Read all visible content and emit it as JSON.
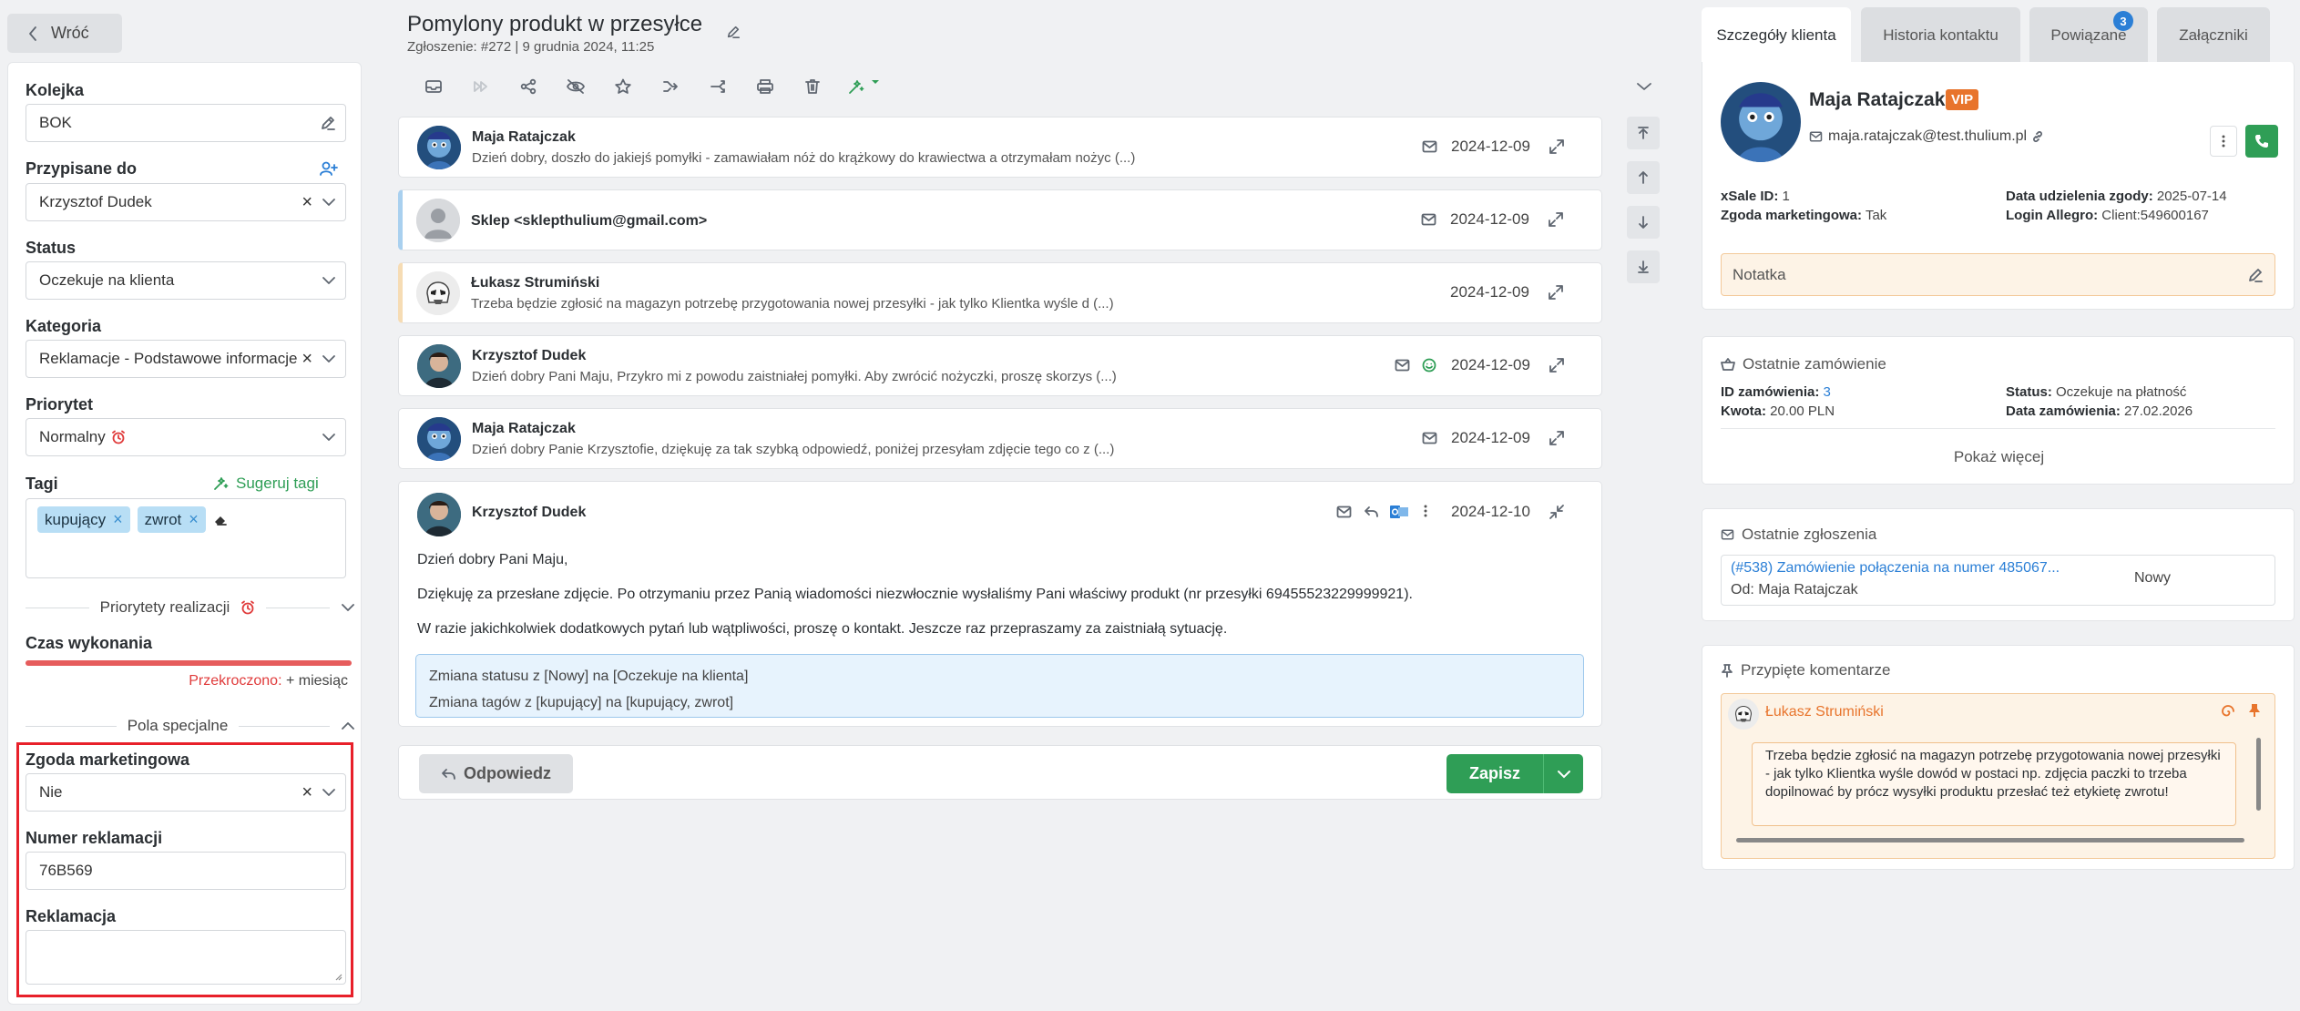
{
  "nav": {
    "back_label": "Wróć"
  },
  "left": {
    "queue": {
      "label": "Kolejka",
      "value": "BOK"
    },
    "assigned": {
      "label": "Przypisane do",
      "value": "Krzysztof Dudek"
    },
    "status": {
      "label": "Status",
      "value": "Oczekuje na klienta"
    },
    "category": {
      "label": "Kategoria",
      "value": "Reklamacje - Podstawowe informacje"
    },
    "priority": {
      "label": "Priorytet",
      "value": "Normalny"
    },
    "tags": {
      "label": "Tagi",
      "suggest_label": "Sugeruj tagi",
      "items": [
        "kupujący",
        "zwrot"
      ]
    },
    "priorities_section": "Priorytety realizacji",
    "exec_time": {
      "label": "Czas wykonania",
      "overdue_label": "Przekroczono:",
      "overdue_value": "+ miesiąc",
      "progress": 1.0
    },
    "special_section": "Pola specjalne",
    "marketing_consent": {
      "label": "Zgoda marketingowa",
      "value": "Nie"
    },
    "complaint_number": {
      "label": "Numer reklamacji",
      "value": "76B569"
    },
    "complaint": {
      "label": "Reklamacja",
      "value": ""
    }
  },
  "ticket": {
    "title": "Pomylony produkt w przesyłce",
    "subtitle": "Zgłoszenie: #272 | 9 grudnia 2024, 11:25"
  },
  "messages": [
    {
      "name": "Maja Ratajczak",
      "preview": "Dzień dobry, doszło do jakiejś pomyłki - zamawiałam nóż do krążkowy do krawiectwa a otrzymałam nożyc (...)",
      "date": "2024-12-09",
      "icon": "envelope-icon",
      "avatar": "sadness"
    },
    {
      "name": "Sklep <sklepthulium@gmail.com>",
      "preview": "",
      "date": "2024-12-09",
      "icon": "envelope-icon",
      "avatar": "generic"
    },
    {
      "name": "Łukasz Strumiński",
      "preview": "Trzeba będzie zgłosić na magazyn potrzebę przygotowania nowej przesyłki - jak tylko Klientka wyśle d (...)",
      "date": "2024-12-09",
      "icon": "",
      "avatar": "trooper"
    },
    {
      "name": "Krzysztof Dudek",
      "preview": "Dzień dobry Pani Maju, Przykro mi z powodu zaistniałej pomyłki. Aby zwrócić nożyczki, proszę skorzys (...)",
      "date": "2024-12-09",
      "icon": "envelope-icon",
      "avatar": "agent"
    },
    {
      "name": "Maja Ratajczak",
      "preview": "Dzień dobry Panie Krzysztofie, dziękuję za tak szybką odpowiedź, poniżej przesyłam zdjęcie tego co z (...)",
      "date": "2024-12-09",
      "icon": "envelope-icon",
      "avatar": "sadness"
    }
  ],
  "open_message": {
    "name": "Krzysztof Dudek",
    "date": "2024-12-10",
    "greeting": "Dzień dobry Pani Maju,",
    "para1": "Dziękuję za przesłane zdjęcie. Po otrzymaniu przez Panią wiadomości niezwłocznie wysłaliśmy Pani właściwy produkt (nr przesyłki 69455523229999921).",
    "para2": "W razie jakichkolwiek dodatkowych pytań lub wątpliwości, proszę o kontakt. Jeszcze raz przepraszamy za zaistniałą sytuację.",
    "note1": "Zmiana statusu z [Nowy] na [Oczekuje na klienta]",
    "note2": "Zmiana tagów z [kupujący] na [kupujący, zwrot]"
  },
  "actions": {
    "reply": "Odpowiedz",
    "save": "Zapisz"
  },
  "tabs": [
    {
      "label": "Szczegóły klienta",
      "active": true
    },
    {
      "label": "Historia kontaktu"
    },
    {
      "label": "Powiązane",
      "badge": "3"
    },
    {
      "label": "Załączniki"
    }
  ],
  "client": {
    "name": "Maja Ratajczak",
    "vip": "VIP",
    "email": "maja.ratajczak@test.thulium.pl",
    "xsale_label": "xSale ID:",
    "xsale": "1",
    "consent_date_label": "Data udzielenia zgody:",
    "consent_date": "2025-07-14",
    "marketing_label": "Zgoda marketingowa:",
    "marketing": "Tak",
    "allegro_label": "Login Allegro:",
    "allegro": "Client:549600167",
    "note_placeholder": "Notatka"
  },
  "last_order": {
    "title": "Ostatnie zamówienie",
    "id_label": "ID zamówienia:",
    "id": "3",
    "status_label": "Status:",
    "status": "Oczekuje na płatność",
    "amount_label": "Kwota:",
    "amount": "20.00 PLN",
    "date_label": "Data zamówienia:",
    "date": "27.02.2026",
    "more": "Pokaż więcej"
  },
  "last_tickets": {
    "title": "Ostatnie zgłoszenia",
    "link": "(#538) Zamówienie połączenia na numer 485067...",
    "from": "Od: Maja Ratajczak",
    "status": "Nowy"
  },
  "pinned": {
    "title": "Przypięte komentarze",
    "author": "Łukasz Strumiński",
    "text": "Trzeba będzie zgłosić na magazyn potrzebę przygotowania nowej przesyłki - jak tylko Klientka wyśle dowód w postaci np. zdjęcia paczki to trzeba dopilnować by prócz wysyłki produktu przesłać też etykietę zwrotu!"
  },
  "colors": {
    "accent": "#2f9e56",
    "link": "#2b7fd6",
    "overdue": "#e03b3b",
    "vip": "#e8742c",
    "highlight_box": "#e8202a"
  }
}
